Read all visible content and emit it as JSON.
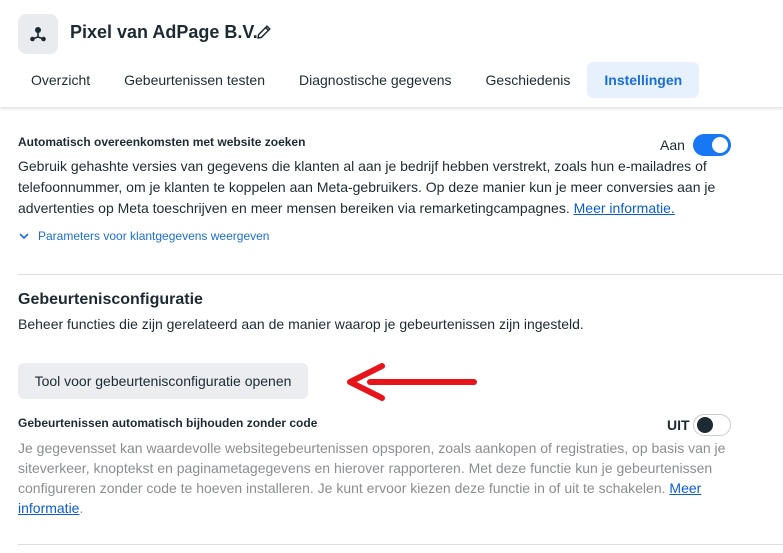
{
  "header": {
    "title": "Pixel van AdPage B.V.",
    "pixel_icon": "pixel-icon",
    "edit_icon": "pencil-icon"
  },
  "tabs": [
    {
      "label": "Overzicht",
      "active": false
    },
    {
      "label": "Gebeurtenissen testen",
      "active": false
    },
    {
      "label": "Diagnostische gegevens",
      "active": false
    },
    {
      "label": "Geschiedenis",
      "active": false
    },
    {
      "label": "Instellingen",
      "active": true
    }
  ],
  "section_matching": {
    "title": "Automatisch overeenkomsten met website zoeken",
    "toggle_label": "Aan",
    "toggle_on": true,
    "description": "Gebruik gehashte versies van gegevens die klanten al aan je bedrijf hebben verstrekt, zoals hun e-mailadres of telefoonnummer, om je klanten te koppelen aan Meta-gebruikers. Op deze manier kun je meer conversies aan je advertenties op Meta toeschrijven en meer mensen bereiken via remarketingcampagnes.",
    "link": "Meer informatie.",
    "params_label": "Parameters voor klantgegevens weergeven"
  },
  "section_config": {
    "title": "Gebeurtenisconfiguratie",
    "description": "Beheer functies die zijn gerelateerd aan de manier waarop je gebeurtenissen zijn ingesteld.",
    "button_label": "Tool voor gebeurtenisconfiguratie openen"
  },
  "section_auto": {
    "title": "Gebeurtenissen automatisch bijhouden zonder code",
    "toggle_label": "UIT",
    "toggle_on": false,
    "description": "Je gegevensset kan waardevolle websitegebeurtenissen opsporen, zoals aankopen of registraties, op basis van je siteverkeer, knoptekst en paginametagegevens en hierover rapporteren. Met deze functie kun je gebeurtenissen configureren zonder code te hoeven installeren. Je kunt ervoor kiezen deze functie in of uit te schakelen.",
    "link": "Meer informatie",
    "link_suffix": "."
  },
  "colors": {
    "accent": "#1877f2",
    "link": "#0a5ecf",
    "annotation_arrow": "#e8141b"
  }
}
